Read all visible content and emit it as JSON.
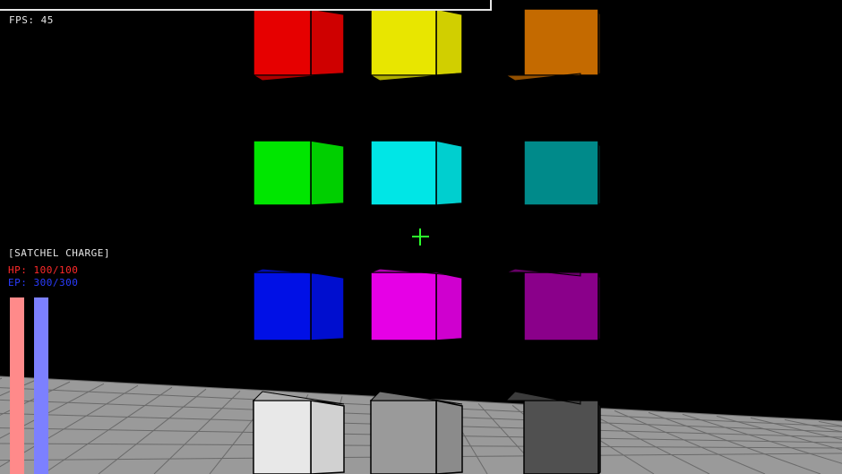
{
  "hud": {
    "fps_label": "FPS: 45",
    "weapon_label": "[SATCHEL CHARGE]",
    "hp_label": "HP: 100/100",
    "ep_label": "EP: 300/300",
    "hp_fraction": 1.0,
    "ep_fraction": 1.0,
    "hp_color": "#ff2a2a",
    "ep_color": "#2a3cff",
    "crosshair_color": "#2cff2c"
  },
  "scene": {
    "background_color": "#000000",
    "floor_color": "#9a9a9a",
    "floor_line_color": "#6a6a6a",
    "cubes": [
      {
        "name": "red",
        "color": "#e60000"
      },
      {
        "name": "yellow",
        "color": "#e8e600"
      },
      {
        "name": "orange",
        "color": "#c46a00"
      },
      {
        "name": "green",
        "color": "#00e600"
      },
      {
        "name": "cyan",
        "color": "#00e6e6"
      },
      {
        "name": "teal",
        "color": "#008a8a"
      },
      {
        "name": "blue",
        "color": "#0010e6"
      },
      {
        "name": "magenta",
        "color": "#e600e6"
      },
      {
        "name": "purple",
        "color": "#8a008a"
      },
      {
        "name": "white",
        "color": "#e8e8e8"
      },
      {
        "name": "light-gray",
        "color": "#9a9a9a"
      },
      {
        "name": "dark-gray",
        "color": "#505050"
      }
    ]
  }
}
